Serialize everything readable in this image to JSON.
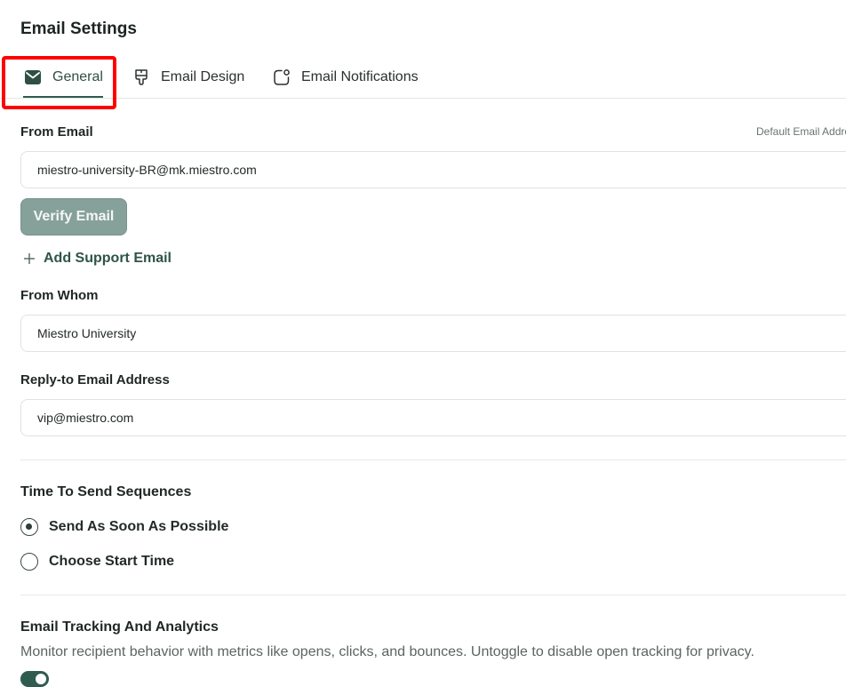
{
  "page": {
    "title": "Email Settings"
  },
  "tabs": [
    {
      "label": "General",
      "icon": "envelope-icon",
      "active": true
    },
    {
      "label": "Email Design",
      "icon": "paint-brush-icon",
      "active": false
    },
    {
      "label": "Email Notifications",
      "icon": "notification-bell-icon",
      "active": false
    }
  ],
  "from_email": {
    "label": "From Email",
    "hint": "Default Email Address",
    "value": "miestro-university-BR@mk.miestro.com",
    "verify_label": "Verify Email",
    "add_support_label": "Add Support Email"
  },
  "from_whom": {
    "label": "From Whom",
    "value": "Miestro University"
  },
  "reply_to": {
    "label": "Reply-to Email Address",
    "value": "vip@miestro.com"
  },
  "sequences": {
    "title": "Time To Send Sequences",
    "options": [
      {
        "label": "Send As Soon As Possible",
        "checked": true
      },
      {
        "label": "Choose Start Time",
        "checked": false
      }
    ]
  },
  "tracking": {
    "title": "Email Tracking And Analytics",
    "description": "Monitor recipient behavior with metrics like opens, clicks, and bounces. Untoggle to disable open tracking for privacy.",
    "enabled": true
  },
  "colors": {
    "accent": "#2f5c4f",
    "highlight": "#ff0000",
    "button": "#86a09a"
  }
}
